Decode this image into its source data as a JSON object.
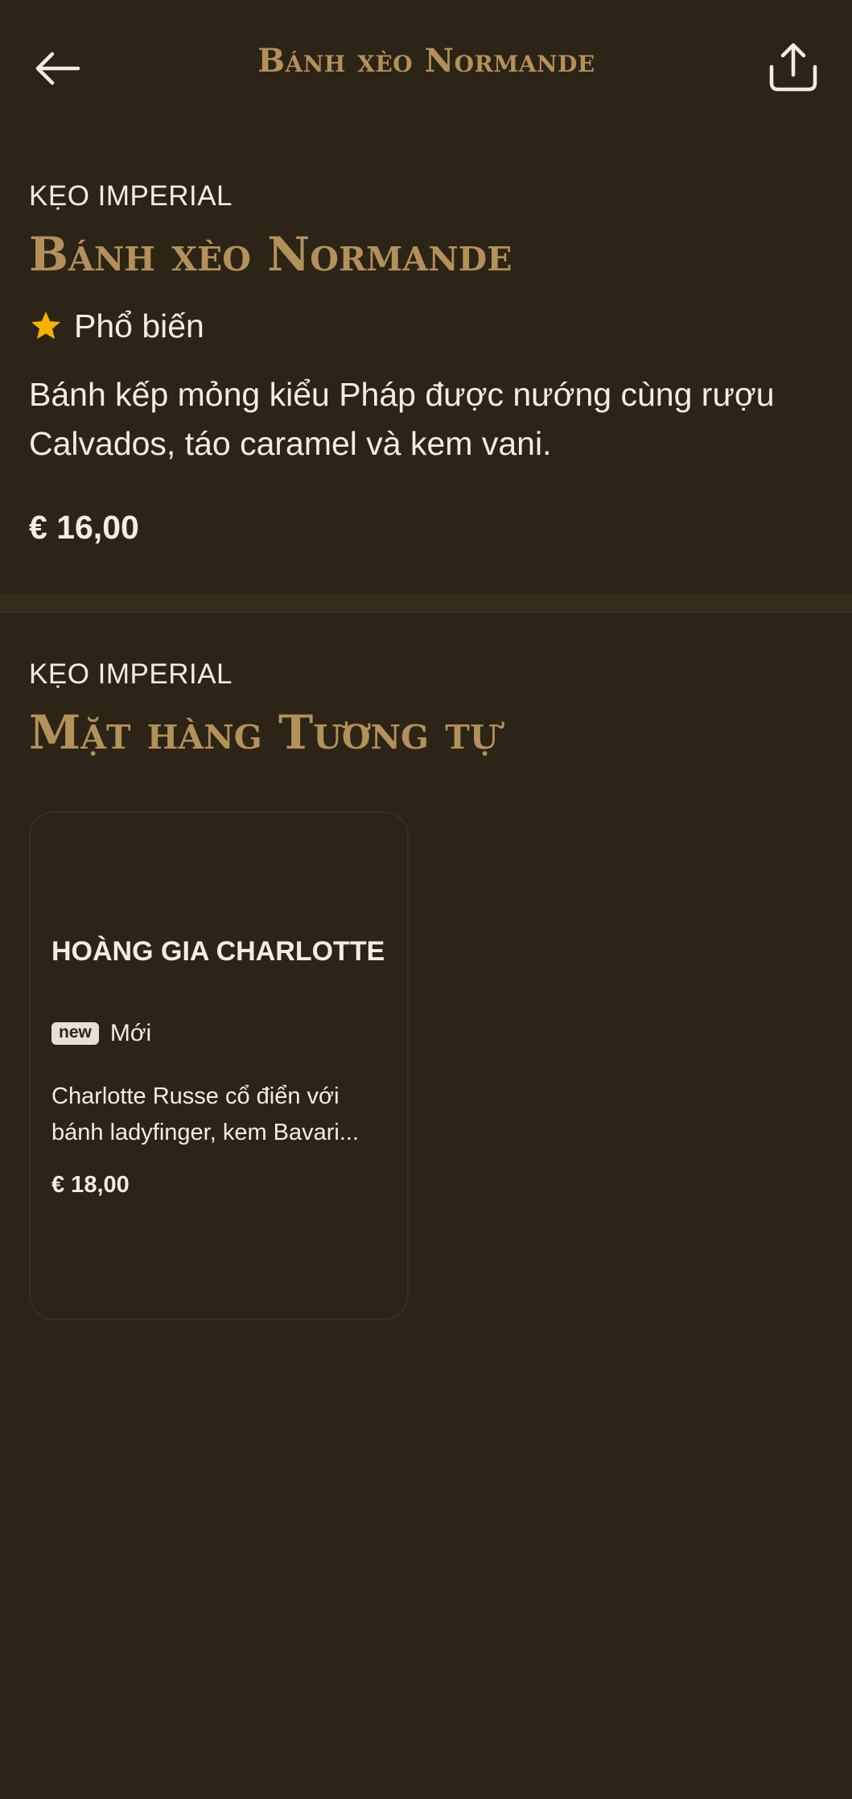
{
  "header": {
    "title": "Bánh xèo Normande",
    "back_icon": "arrow-left-icon",
    "share_icon": "share-upload-icon"
  },
  "item": {
    "category": "KẸO IMPERIAL",
    "title": "Bánh xèo Normande",
    "badge_icon": "star-icon",
    "badge_label": "Phổ biến",
    "description": "Bánh kếp mỏng kiểu Pháp được nướng cùng rượu Calvados, táo caramel và kem vani.",
    "price": "€ 16,00"
  },
  "similar": {
    "category": "KẸO IMPERIAL",
    "title": "Mặt hàng Tương tự",
    "items": [
      {
        "title": "HOÀNG GIA CHARLOTTE",
        "badge_pill": "new",
        "badge_label": "Mới",
        "description_line1": "Charlotte Russe cổ điển với",
        "description_line2": "bánh ladyfinger, kem Bavari...",
        "price": "€ 18,00"
      }
    ]
  },
  "colors": {
    "background": "#2c2416",
    "accent_gold": "#b4915a",
    "text": "#f4ede2",
    "star": "#f5b400",
    "divider": "#352b1c"
  }
}
